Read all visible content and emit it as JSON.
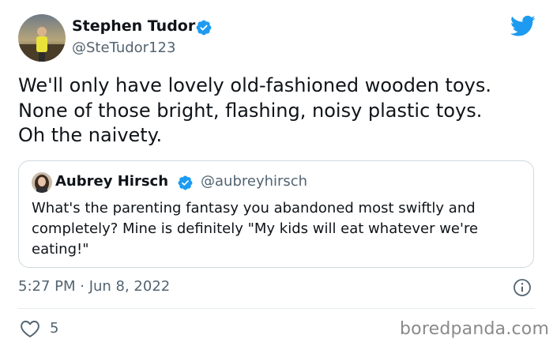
{
  "author": {
    "name": "Stephen Tudor",
    "handle": "@SteTudor123",
    "verified": true
  },
  "tweet": {
    "lines": [
      "We'll only have lovely old-fashioned wooden toys.",
      "None of those bright, flashing, noisy plastic toys.",
      "Oh the naivety."
    ]
  },
  "quoted": {
    "name": "Aubrey Hirsch",
    "handle": "@aubreyhirsch",
    "verified": true,
    "lines": [
      "What's the parenting fantasy you abandoned most swiftly and",
      "completely? Mine is definitely \"My kids will eat whatever we're",
      "eating!\""
    ]
  },
  "meta": {
    "timestamp": "5:27 PM · Jun 8, 2022",
    "like_count": "5"
  },
  "watermark": "boredpanda.com",
  "colors": {
    "twitter_blue": "#1d9bf0",
    "secondary_text": "#536471",
    "border": "#cfd9de"
  },
  "icons": {
    "logo": "twitter-bird-icon",
    "verified": "verified-badge-icon",
    "info": "info-icon",
    "like": "heart-icon"
  }
}
